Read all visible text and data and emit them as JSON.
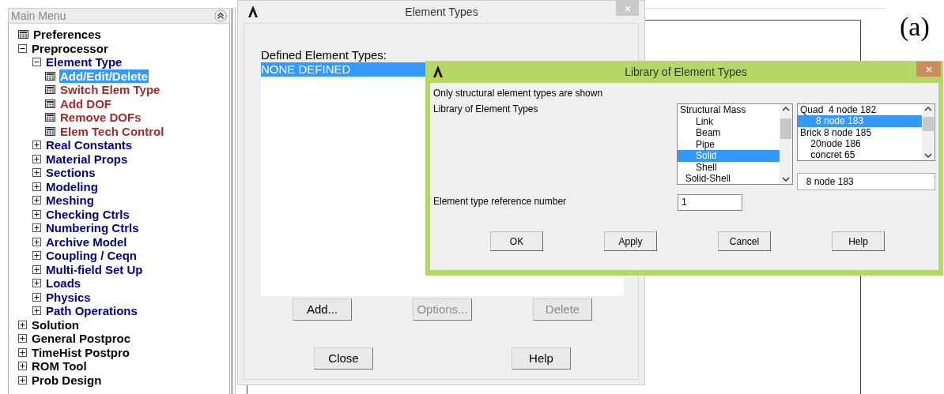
{
  "main_menu": {
    "title": "Main Menu",
    "items": [
      {
        "label": "Preferences",
        "kind": "leaf",
        "selected": false
      },
      {
        "label": "Preprocessor",
        "kind": "folder",
        "expanded": true,
        "children": [
          {
            "label": "Element Type",
            "kind": "folder",
            "expanded": true,
            "children": [
              {
                "label": "Add/Edit/Delete",
                "kind": "leaf",
                "selected": true
              },
              {
                "label": "Switch Elem Type",
                "kind": "leaf",
                "selected": false
              },
              {
                "label": "Add DOF",
                "kind": "leaf",
                "selected": false
              },
              {
                "label": "Remove DOFs",
                "kind": "leaf",
                "selected": false
              },
              {
                "label": "Elem Tech Control",
                "kind": "leaf",
                "selected": false
              }
            ]
          },
          {
            "label": "Real Constants",
            "kind": "folder",
            "expanded": false
          },
          {
            "label": "Material Props",
            "kind": "folder",
            "expanded": false
          },
          {
            "label": "Sections",
            "kind": "folder",
            "expanded": false
          },
          {
            "label": "Modeling",
            "kind": "folder",
            "expanded": false
          },
          {
            "label": "Meshing",
            "kind": "folder",
            "expanded": false
          },
          {
            "label": "Checking Ctrls",
            "kind": "folder",
            "expanded": false
          },
          {
            "label": "Numbering Ctrls",
            "kind": "folder",
            "expanded": false
          },
          {
            "label": "Archive Model",
            "kind": "folder",
            "expanded": false
          },
          {
            "label": "Coupling / Ceqn",
            "kind": "folder",
            "expanded": false
          },
          {
            "label": "Multi-field Set Up",
            "kind": "folder",
            "expanded": false
          },
          {
            "label": "Loads",
            "kind": "folder",
            "expanded": false
          },
          {
            "label": "Physics",
            "kind": "folder",
            "expanded": false
          },
          {
            "label": "Path Operations",
            "kind": "folder",
            "expanded": false
          }
        ]
      },
      {
        "label": "Solution",
        "kind": "folder",
        "expanded": false
      },
      {
        "label": "General Postproc",
        "kind": "folder",
        "expanded": false
      },
      {
        "label": "TimeHist Postpro",
        "kind": "folder",
        "expanded": false
      },
      {
        "label": "ROM Tool",
        "kind": "folder",
        "expanded": false
      },
      {
        "label": "Prob Design",
        "kind": "folder",
        "expanded": false
      }
    ]
  },
  "figure_label": "(a)",
  "element_types_dialog": {
    "title": "Element Types",
    "list_label": "Defined Element Types:",
    "list_items": [
      {
        "label": "NONE DEFINED",
        "selected": true
      }
    ],
    "buttons": [
      {
        "label": "Add...",
        "disabled": false
      },
      {
        "label": "Options...",
        "disabled": true
      },
      {
        "label": "Delete",
        "disabled": true
      }
    ],
    "footer_buttons": [
      "Close",
      "Help"
    ]
  },
  "library_dialog": {
    "title": "Library of Element Types",
    "note": "Only structural element types are shown",
    "library_label": "Library of Element Types",
    "categories": [
      {
        "label": "Structural Mass",
        "selected": false
      },
      {
        "label": "      Link",
        "selected": false
      },
      {
        "label": "      Beam",
        "selected": false
      },
      {
        "label": "      Pipe",
        "selected": false
      },
      {
        "label": "      Solid",
        "selected": true
      },
      {
        "label": "      Shell",
        "selected": false
      },
      {
        "label": "  Solid-Shell",
        "selected": false
      }
    ],
    "types": [
      {
        "label": "Quad  4 node 182",
        "selected": false
      },
      {
        "label": "      8 node 183",
        "selected": true
      },
      {
        "label": "Brick 8 node 185",
        "selected": false
      },
      {
        "label": "    20node 186",
        "selected": false
      },
      {
        "label": "    concret 65",
        "selected": false
      }
    ],
    "type_field": "  8 node 183",
    "ref_label": "Element type reference number",
    "ref_value": "1",
    "buttons": [
      "OK",
      "Apply",
      "Cancel",
      "Help"
    ]
  }
}
